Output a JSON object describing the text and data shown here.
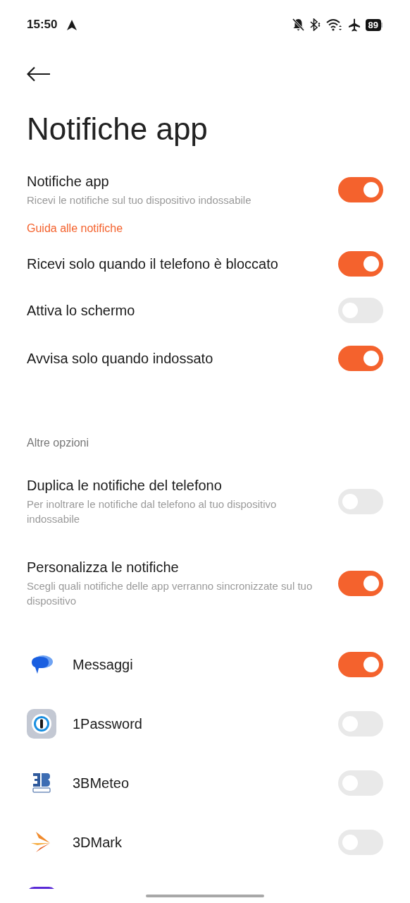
{
  "status_bar": {
    "time": "15:50",
    "battery": "89"
  },
  "title": "Notifiche app",
  "main_toggle": {
    "label": "Notifiche app",
    "subtitle": "Ricevi le notifiche sul tuo dispositivo indossabile",
    "on": true
  },
  "guide_link": "Guida alle notifiche",
  "options": [
    {
      "label": "Ricevi solo quando il telefono è bloccato",
      "on": true
    },
    {
      "label": "Attiva lo schermo",
      "on": false
    },
    {
      "label": "Avvisa solo quando indossato",
      "on": true
    }
  ],
  "section_header": "Altre opzioni",
  "more_options": [
    {
      "label": "Duplica le notifiche del telefono",
      "subtitle": "Per inoltrare le notifiche dal telefono al tuo dispositivo indossabile",
      "on": false
    },
    {
      "label": "Personalizza le notifiche",
      "subtitle": "Scegli quali notifiche delle app verranno sincronizzate sul tuo dispositivo",
      "on": true
    }
  ],
  "apps": [
    {
      "kind": "messages",
      "name": "Messaggi",
      "on": true
    },
    {
      "kind": "password",
      "name": "1Password",
      "on": false
    },
    {
      "kind": "weather",
      "name": "3BMeteo",
      "on": false
    },
    {
      "kind": "benchmark",
      "name": "3DMark",
      "on": false
    },
    {
      "kind": "cut"
    }
  ]
}
